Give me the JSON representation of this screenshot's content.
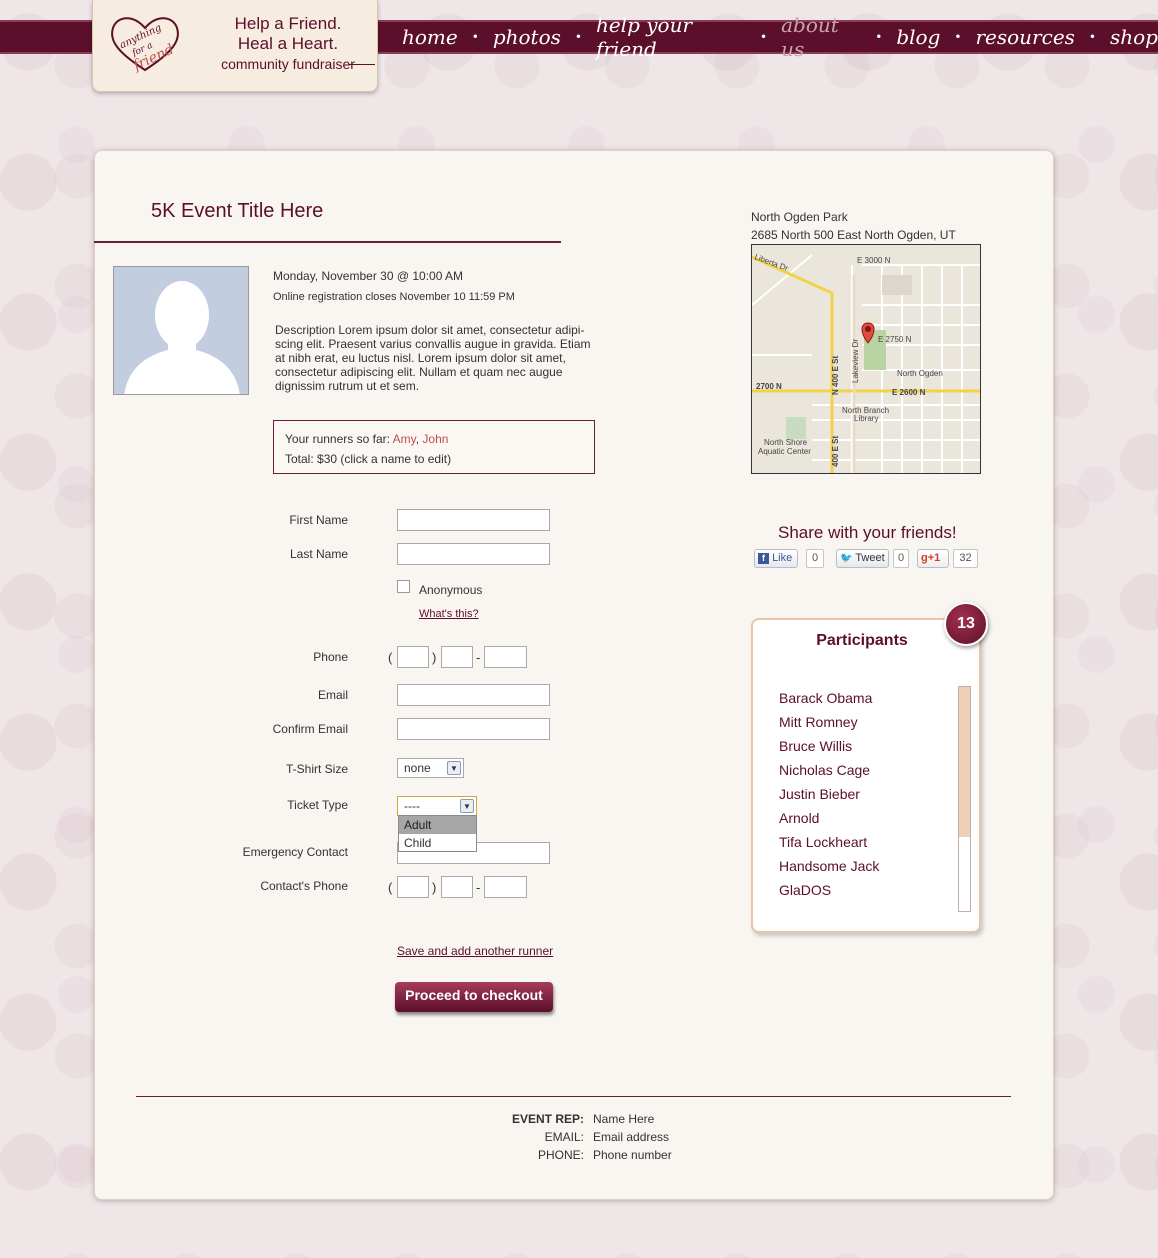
{
  "logo": {
    "line1": "Help a Friend.",
    "line2": "Heal a Heart.",
    "line3": "community fundraiser",
    "brand": "anything for a friend"
  },
  "nav": {
    "items": [
      {
        "label": "home",
        "active": false
      },
      {
        "label": "photos",
        "active": false
      },
      {
        "label": "help your friend",
        "active": false
      },
      {
        "label": "about us",
        "active": true
      },
      {
        "label": "blog",
        "active": false
      },
      {
        "label": "resources",
        "active": false
      },
      {
        "label": "shop",
        "active": false
      }
    ]
  },
  "event": {
    "title": "5K Event Title Here",
    "date": "Monday, November 30 @ 10:00 AM",
    "registration": "Online registration closes November 10 11:59 PM",
    "description": "Description Lorem ipsum dolor sit amet, consectetur adipi-scing elit. Praesent varius convallis augue in gravida. Etiam at nibh erat, eu luctus nisl. Lorem ipsum dolor sit amet, consectetur adipiscing elit. Nullam et quam nec augue dignissim rutrum ut et sem."
  },
  "runners": {
    "prefix": "Your runners so far:",
    "names": [
      "Amy",
      "John"
    ],
    "total": "Total: $30 (click a name to edit)"
  },
  "form": {
    "first_name_label": "First Name",
    "last_name_label": "Last Name",
    "anonymous_label": "Anonymous",
    "whats_this": "What's this?",
    "phone_label": "Phone",
    "email_label": "Email",
    "confirm_email_label": "Confirm Email",
    "tshirt_label": "T-Shirt Size",
    "tshirt_value": "none",
    "ticket_label": "Ticket Type",
    "ticket_value": "----",
    "ticket_options": [
      "Adult",
      "Child"
    ],
    "emergency_label": "Emergency Contact",
    "contact_phone_label": "Contact's Phone",
    "paren_open": "(",
    "paren_close": ")",
    "dash": "-",
    "save_link": "Save and add another runner",
    "checkout_button": "Proceed to checkout"
  },
  "venue": {
    "name": "North Ogden Park",
    "address": "2685 North 500 East North Ogden, UT"
  },
  "map": {
    "labels": [
      "Liberta Dr",
      "E 3000 N",
      "E 2750 N",
      "North Ogden",
      "2700 N",
      "E 2600 N",
      "N 400 E St",
      "Lakeview Dr",
      "North Branch Library",
      "North Shore Aquatic Center",
      "400 E St"
    ]
  },
  "share": {
    "title": "Share with your friends!",
    "like_label": "Like",
    "like_count": "0",
    "tweet_label": "Tweet",
    "tweet_count": "0",
    "plus_label": "+1",
    "plus_count": "32"
  },
  "participants": {
    "title": "Participants",
    "count": "13",
    "names": [
      "Barack Obama",
      "Mitt Romney",
      "Bruce Willis",
      "Nicholas Cage",
      "Justin Bieber",
      "Arnold",
      "Tifa Lockheart",
      "Handsome Jack",
      "GlaDOS"
    ]
  },
  "footer": {
    "rep_key": "EVENT REP:",
    "rep_value": "Name Here",
    "email_key": "EMAIL:",
    "email_value": "Email address",
    "phone_key": "PHONE:",
    "phone_value": "Phone number"
  },
  "colors": {
    "brand": "#5c0f2a",
    "accent_link": "#c0504d",
    "card_bg": "#f9f5f0"
  }
}
